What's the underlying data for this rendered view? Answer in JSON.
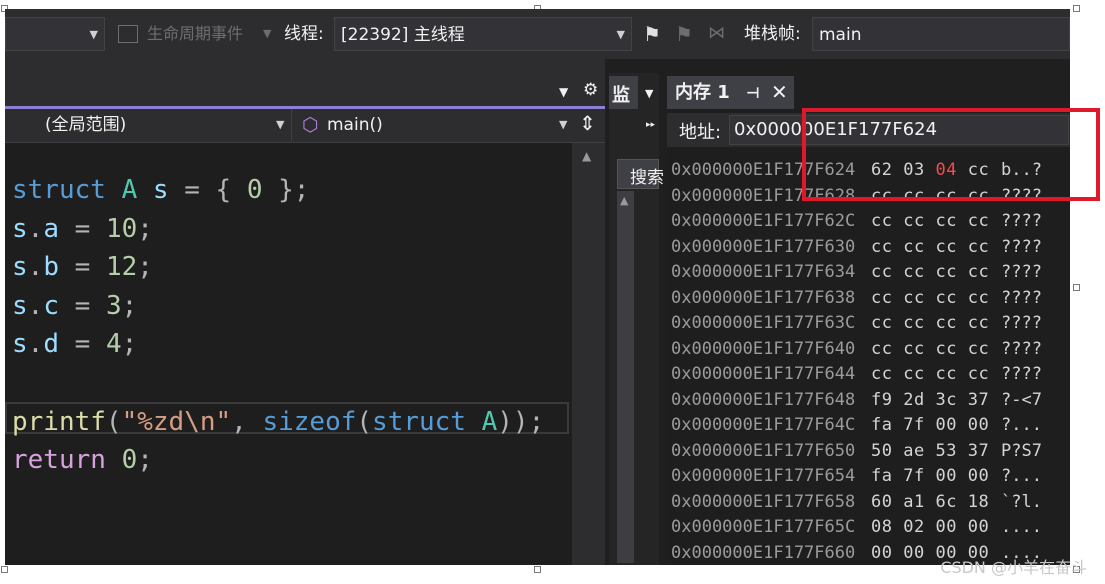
{
  "toolbar": {
    "lifecycle_events": "生命周期事件",
    "thread_label": "线程:",
    "thread_value": "[22392] 主线程",
    "stack_frame_label": "堆栈帧:",
    "stack_frame_value": "main"
  },
  "code_editor": {
    "scope": "(全局范围)",
    "function": "main()",
    "lines": [
      {
        "tokens": [
          {
            "t": "struct",
            "c": "kw"
          },
          {
            "t": " "
          },
          {
            "t": "A",
            "c": "ty"
          },
          {
            "t": " "
          },
          {
            "t": "s",
            "c": "var"
          },
          {
            "t": " = { ",
            "c": "op"
          },
          {
            "t": "0",
            "c": "num"
          },
          {
            "t": " };",
            "c": "op"
          }
        ]
      },
      {
        "tokens": [
          {
            "t": "s",
            "c": "var"
          },
          {
            "t": ".",
            "c": "op"
          },
          {
            "t": "a",
            "c": "var"
          },
          {
            "t": " = ",
            "c": "op"
          },
          {
            "t": "10",
            "c": "num"
          },
          {
            "t": ";",
            "c": "op"
          }
        ]
      },
      {
        "tokens": [
          {
            "t": "s",
            "c": "var"
          },
          {
            "t": ".",
            "c": "op"
          },
          {
            "t": "b",
            "c": "var"
          },
          {
            "t": " = ",
            "c": "op"
          },
          {
            "t": "12",
            "c": "num"
          },
          {
            "t": ";",
            "c": "op"
          }
        ]
      },
      {
        "tokens": [
          {
            "t": "s",
            "c": "var"
          },
          {
            "t": ".",
            "c": "op"
          },
          {
            "t": "c",
            "c": "var"
          },
          {
            "t": " = ",
            "c": "op"
          },
          {
            "t": "3",
            "c": "num"
          },
          {
            "t": ";",
            "c": "op"
          }
        ]
      },
      {
        "tokens": [
          {
            "t": "s",
            "c": "var"
          },
          {
            "t": ".",
            "c": "op"
          },
          {
            "t": "d",
            "c": "var"
          },
          {
            "t": " = ",
            "c": "op"
          },
          {
            "t": "4",
            "c": "num"
          },
          {
            "t": ";",
            "c": "op"
          }
        ]
      },
      {
        "tokens": []
      },
      {
        "tokens": [
          {
            "t": "printf",
            "c": "fn"
          },
          {
            "t": "(",
            "c": "op"
          },
          {
            "t": "\"%zd\\n\"",
            "c": "str"
          },
          {
            "t": ", ",
            "c": "op"
          },
          {
            "t": "sizeof",
            "c": "kw"
          },
          {
            "t": "(",
            "c": "op"
          },
          {
            "t": "struct",
            "c": "kw"
          },
          {
            "t": " "
          },
          {
            "t": "A",
            "c": "ty"
          },
          {
            "t": "));",
            "c": "op"
          }
        ]
      },
      {
        "tokens": [
          {
            "t": "return",
            "c": "ctl"
          },
          {
            "t": " "
          },
          {
            "t": "0",
            "c": "num"
          },
          {
            "t": ";",
            "c": "op"
          }
        ]
      }
    ]
  },
  "watch_pane": {
    "tab_label": "监",
    "search_label": "搜索"
  },
  "memory_window": {
    "title": "内存 1",
    "address_label": "地址:",
    "address_value": "0x000000E1F177F624",
    "rows": [
      {
        "addr": "0x000000E1F177F624",
        "bytes": [
          "62",
          "03",
          "04",
          "cc"
        ],
        "chars": "b..?",
        "changed": [
          2
        ]
      },
      {
        "addr": "0x000000E1F177F628",
        "bytes": [
          "cc",
          "cc",
          "cc",
          "cc"
        ],
        "chars": "????",
        "changed": []
      },
      {
        "addr": "0x000000E1F177F62C",
        "bytes": [
          "cc",
          "cc",
          "cc",
          "cc"
        ],
        "chars": "????",
        "changed": []
      },
      {
        "addr": "0x000000E1F177F630",
        "bytes": [
          "cc",
          "cc",
          "cc",
          "cc"
        ],
        "chars": "????",
        "changed": []
      },
      {
        "addr": "0x000000E1F177F634",
        "bytes": [
          "cc",
          "cc",
          "cc",
          "cc"
        ],
        "chars": "????",
        "changed": []
      },
      {
        "addr": "0x000000E1F177F638",
        "bytes": [
          "cc",
          "cc",
          "cc",
          "cc"
        ],
        "chars": "????",
        "changed": []
      },
      {
        "addr": "0x000000E1F177F63C",
        "bytes": [
          "cc",
          "cc",
          "cc",
          "cc"
        ],
        "chars": "????",
        "changed": []
      },
      {
        "addr": "0x000000E1F177F640",
        "bytes": [
          "cc",
          "cc",
          "cc",
          "cc"
        ],
        "chars": "????",
        "changed": []
      },
      {
        "addr": "0x000000E1F177F644",
        "bytes": [
          "cc",
          "cc",
          "cc",
          "cc"
        ],
        "chars": "????",
        "changed": []
      },
      {
        "addr": "0x000000E1F177F648",
        "bytes": [
          "f9",
          "2d",
          "3c",
          "37"
        ],
        "chars": "?-<7",
        "changed": []
      },
      {
        "addr": "0x000000E1F177F64C",
        "bytes": [
          "fa",
          "7f",
          "00",
          "00"
        ],
        "chars": "?...",
        "changed": []
      },
      {
        "addr": "0x000000E1F177F650",
        "bytes": [
          "50",
          "ae",
          "53",
          "37"
        ],
        "chars": "P?S7",
        "changed": []
      },
      {
        "addr": "0x000000E1F177F654",
        "bytes": [
          "fa",
          "7f",
          "00",
          "00"
        ],
        "chars": "?...",
        "changed": []
      },
      {
        "addr": "0x000000E1F177F658",
        "bytes": [
          "60",
          "a1",
          "6c",
          "18"
        ],
        "chars": "`?l.",
        "changed": []
      },
      {
        "addr": "0x000000E1F177F65C",
        "bytes": [
          "08",
          "02",
          "00",
          "00"
        ],
        "chars": "....",
        "changed": []
      },
      {
        "addr": "0x000000E1F177F660",
        "bytes": [
          "00",
          "00",
          "00",
          "00"
        ],
        "chars": "....",
        "changed": []
      }
    ]
  },
  "watermark": "CSDN @小羊在奋斗",
  "colors": {
    "changed_byte": "#f14c4c",
    "highlight_box": "#e0182c",
    "code_accent": "#8f7fd4"
  }
}
